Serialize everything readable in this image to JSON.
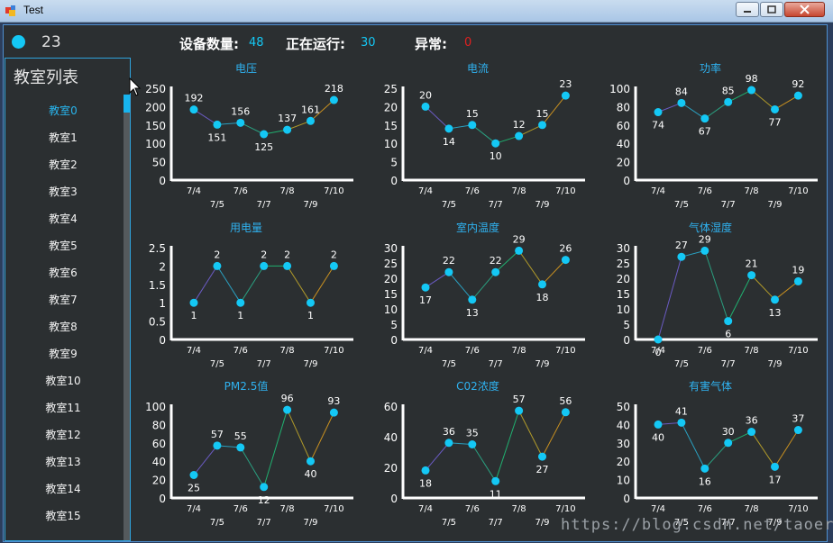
{
  "window": {
    "title": "Test"
  },
  "header": {
    "status_count": "23",
    "device_label": "设备数量:",
    "device_value": "48",
    "running_label": "正在运行:",
    "running_value": "30",
    "abnormal_label": "异常:",
    "abnormal_value": "0",
    "colors": {
      "led": "#14c8f5",
      "device_value": "#14c8f5",
      "running_value": "#14c8f5",
      "abnormal_value": "#e02020"
    }
  },
  "sidebar": {
    "title": "教室列表",
    "selected_index": 0,
    "items": [
      "教室0",
      "教室1",
      "教室2",
      "教室3",
      "教室4",
      "教室5",
      "教室6",
      "教室7",
      "教室8",
      "教室9",
      "教室10",
      "教室11",
      "教室12",
      "教室13",
      "教室14",
      "教室15"
    ]
  },
  "chart_data": [
    {
      "type": "line",
      "title": "电压",
      "categories": [
        "7/4",
        "7/5",
        "7/6",
        "7/7",
        "7/8",
        "7/9",
        "7/10"
      ],
      "values": [
        192,
        151,
        156,
        125,
        137,
        161,
        218
      ],
      "ylim": [
        0,
        250
      ],
      "yticks": [
        "0",
        "50",
        "100",
        "150",
        "200",
        "250"
      ]
    },
    {
      "type": "line",
      "title": "电流",
      "categories": [
        "7/4",
        "7/5",
        "7/6",
        "7/7",
        "7/8",
        "7/9",
        "7/10"
      ],
      "values": [
        20,
        14,
        15,
        10,
        12,
        15,
        23
      ],
      "ylim": [
        0,
        25
      ],
      "yticks": [
        "0",
        "5",
        "10",
        "15",
        "20",
        "25"
      ]
    },
    {
      "type": "line",
      "title": "功率",
      "categories": [
        "7/4",
        "7/5",
        "7/6",
        "7/7",
        "7/8",
        "7/9",
        "7/10"
      ],
      "values": [
        74,
        84,
        67,
        85,
        98,
        77,
        92
      ],
      "ylim": [
        0,
        100
      ],
      "yticks": [
        "0",
        "20",
        "40",
        "60",
        "80",
        "100"
      ]
    },
    {
      "type": "line",
      "title": "用电量",
      "categories": [
        "7/4",
        "7/5",
        "7/6",
        "7/7",
        "7/8",
        "7/9",
        "7/10"
      ],
      "values": [
        1,
        2,
        1,
        2,
        2,
        1,
        2
      ],
      "ylim": [
        0,
        2.5
      ],
      "yticks": [
        "0",
        "0.5",
        "1",
        "1.5",
        "2",
        "2.5"
      ]
    },
    {
      "type": "line",
      "title": "室内温度",
      "categories": [
        "7/4",
        "7/5",
        "7/6",
        "7/7",
        "7/8",
        "7/9",
        "7/10"
      ],
      "values": [
        17,
        22,
        13,
        22,
        29,
        18,
        26
      ],
      "ylim": [
        0,
        30
      ],
      "yticks": [
        "0",
        "5",
        "10",
        "15",
        "20",
        "25",
        "30"
      ]
    },
    {
      "type": "line",
      "title": "气体湿度",
      "categories": [
        "7/4",
        "7/5",
        "7/6",
        "7/7",
        "7/8",
        "7/9",
        "7/10"
      ],
      "values": [
        0,
        27,
        29,
        6,
        21,
        13,
        19
      ],
      "ylim": [
        0,
        30
      ],
      "yticks": [
        "0",
        "5",
        "10",
        "15",
        "20",
        "25",
        "30"
      ]
    },
    {
      "type": "line",
      "title": "PM2.5值",
      "categories": [
        "7/4",
        "7/5",
        "7/6",
        "7/7",
        "7/8",
        "7/9",
        "7/10"
      ],
      "values": [
        25,
        57,
        55,
        12,
        96,
        40,
        93
      ],
      "ylim": [
        0,
        100
      ],
      "yticks": [
        "0",
        "20",
        "40",
        "60",
        "80",
        "100"
      ]
    },
    {
      "type": "line",
      "title": "C02浓度",
      "categories": [
        "7/4",
        "7/5",
        "7/6",
        "7/7",
        "7/8",
        "7/9",
        "7/10"
      ],
      "values": [
        18,
        36,
        35,
        11,
        57,
        27,
        56
      ],
      "ylim": [
        0,
        60
      ],
      "yticks": [
        "0",
        "20",
        "40",
        "60"
      ]
    },
    {
      "type": "line",
      "title": "有害气体",
      "categories": [
        "7/4",
        "7/5",
        "7/6",
        "7/7",
        "7/8",
        "7/9",
        "7/10"
      ],
      "values": [
        40,
        41,
        16,
        30,
        36,
        17,
        37
      ],
      "ylim": [
        0,
        50
      ],
      "yticks": [
        "0",
        "10",
        "20",
        "30",
        "40",
        "50"
      ]
    }
  ],
  "chart_style": {
    "point_color": "#14c8f5",
    "axis_color": "#ffffff",
    "title_color": "#2fb2f0",
    "label_color": "#ffffff",
    "segment_colors": [
      "#6b5bc4",
      "#2aa0c0",
      "#2aa080",
      "#20b070",
      "#b09a2a",
      "#c89020"
    ]
  },
  "watermark": "https://blog.csdn.net/taoerit"
}
